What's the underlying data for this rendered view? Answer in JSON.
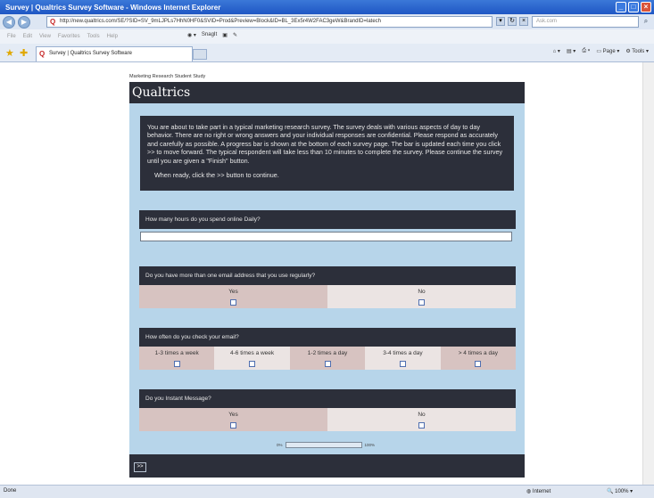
{
  "window": {
    "title": "Survey | Qualtrics Survey Software - Windows Internet Explorer"
  },
  "address": {
    "url": "http://new.qualtrics.com/SE/?SID=SV_9mLJPLs7HhN0HF0&SVID=Prod&Preview=Block&ID=BL_3Ex5r4W2FAC3geW&BrandID=latech",
    "search_placeholder": "Ask.com"
  },
  "menu": {
    "items": [
      "File",
      "Edit",
      "View",
      "Favorites",
      "Tools",
      "Help"
    ],
    "snagit": "SnagIt"
  },
  "tabs": {
    "active_label": "Survey | Qualtrics Survey Software",
    "page_label": "Page",
    "tools_label": "Tools"
  },
  "survey": {
    "study_title": "Marketing Research Student Study",
    "brand": "Qualtrics",
    "intro_text": "You are about to take part in a typical marketing research survey.  The survey deals with various aspects of day to day behavior.  There are no right or wrong answers and your individual responses are confidential.  Please respond as accurately and carefully as possible.  A progress bar is shown at the bottom of each survey page.  The bar is updated each time you click >> to move forward.  The typical respondent will take less than 10 minutes to complete the survey.  Please continue the survey until you are given a \"Finish\" button.",
    "ready_text": "When ready, click the >> button to continue.",
    "q1": {
      "text": "How many hours do you spend online Daily?",
      "value": ""
    },
    "q2": {
      "text": "Do you have more than one email address that you use regularly?",
      "options": [
        "Yes",
        "No"
      ]
    },
    "q3": {
      "text": "How often do you check your email?",
      "options": [
        "1-3 times a week",
        "4-6 times a week",
        "1-2 times a day",
        "3-4 times a day",
        "> 4 times a day"
      ]
    },
    "q4": {
      "text": "Do you Instant Message?",
      "options": [
        "Yes",
        "No"
      ]
    },
    "progress": {
      "min_label": "0%",
      "max_label": "100%",
      "value": 0
    },
    "next_label": ">>"
  },
  "status": {
    "left": "Done",
    "zone": "Internet",
    "zoom": "100%"
  }
}
